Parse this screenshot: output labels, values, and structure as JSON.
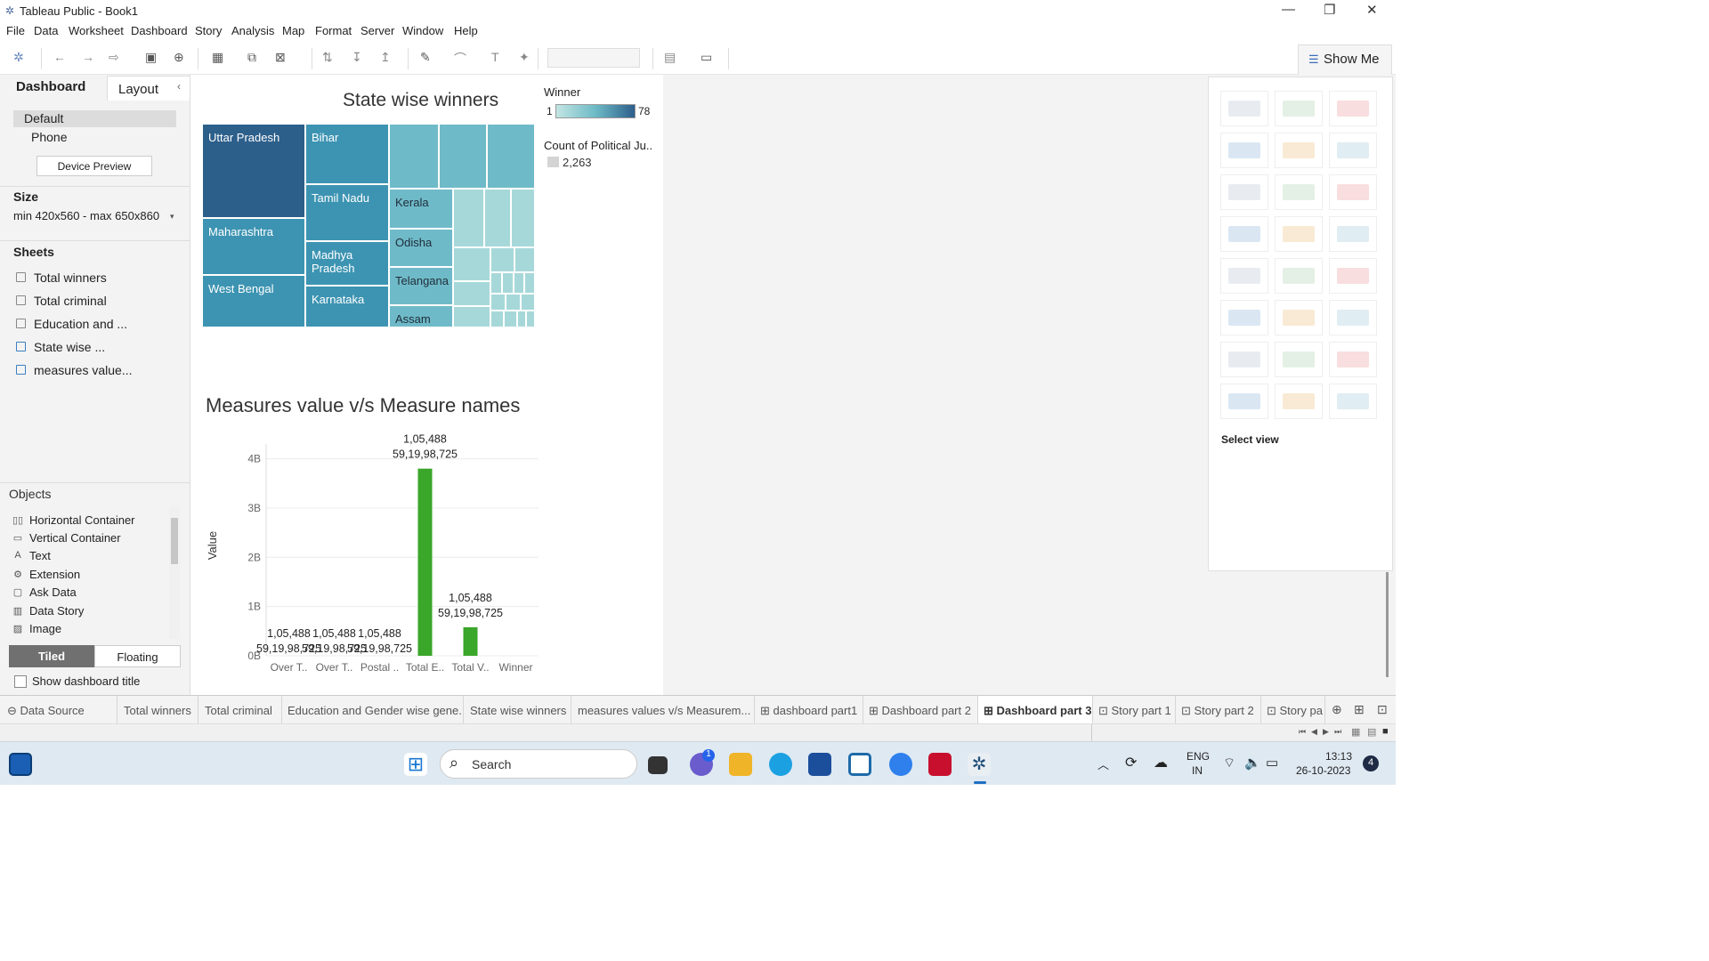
{
  "window": {
    "title": "Tableau Public - Book1"
  },
  "menu": [
    "File",
    "Data",
    "Worksheet",
    "Dashboard",
    "Story",
    "Analysis",
    "Map",
    "Format",
    "Server",
    "Window",
    "Help"
  ],
  "show_me": {
    "label": "Show Me",
    "select_view": "Select view"
  },
  "left_panel": {
    "tab_dashboard": "Dashboard",
    "tab_layout": "Layout",
    "device_default": "Default",
    "device_phone": "Phone",
    "device_preview": "Device Preview",
    "size_title": "Size",
    "size_value": "min 420x560 - max 650x860",
    "sheets_title": "Sheets",
    "sheets": [
      "Total winners",
      "Total criminal",
      "Education and ...",
      "State wise ...",
      "measures value..."
    ],
    "objects_title": "Objects",
    "objects": [
      {
        "label": "Horizontal Container",
        "icon": "horizontal-container-icon"
      },
      {
        "label": "Vertical Container",
        "icon": "vertical-container-icon"
      },
      {
        "label": "Text",
        "icon": "text-icon"
      },
      {
        "label": "Extension",
        "icon": "extension-icon"
      },
      {
        "label": "Ask Data",
        "icon": "ask-data-icon"
      },
      {
        "label": "Data Story",
        "icon": "data-story-icon"
      },
      {
        "label": "Image",
        "icon": "image-icon"
      }
    ],
    "tiled": "Tiled",
    "floating": "Floating",
    "show_title": "Show dashboard title"
  },
  "treemap": {
    "title": "State wise winners",
    "legend_title": "Winner",
    "legend_min": "1",
    "legend_max": "78",
    "count_title": "Count of Political Ju..",
    "count_value": "2,263",
    "labels": [
      "Uttar Pradesh",
      "Bihar",
      "Maharashtra",
      "Tamil Nadu",
      "West Bengal",
      "Madhya Pradesh",
      "Karnataka",
      "Kerala",
      "Odisha",
      "Telangana",
      "Assam"
    ],
    "colors": {
      "dark": "#2d5f8b",
      "mid": "#3d94b2",
      "light": "#6fbac8",
      "pale": "#a7d8d9"
    }
  },
  "chart_data": {
    "type": "bar",
    "title": "Measures value v/s Measure names",
    "ylabel": "Value",
    "categories": [
      "Over T..",
      "Over T..",
      "Postal ..",
      "Total E..",
      "Total V..",
      "Winner"
    ],
    "values": [
      0,
      0,
      0,
      3.8,
      0.58,
      0
    ],
    "value_unit": "B",
    "ylim": [
      0,
      4.3
    ],
    "yticks": [
      "0B",
      "1B",
      "2B",
      "3B",
      "4B"
    ],
    "labels_top": [
      "1,05,488",
      "1,05,488",
      "1,05,488",
      "1,05,488",
      "1,05,488"
    ],
    "labels_bottom": [
      "59,19,98,725",
      "59,19,98,725",
      "59,19,98,725",
      "59,19,98,725",
      "59,19,98,725"
    ],
    "bar_color": "#3aa62a"
  },
  "sheet_tabs": [
    "Data Source",
    "Total winners",
    "Total criminal",
    "Education and Gender wise gene...",
    "State wise winners",
    "measures values v/s Measurem...",
    "dashboard part1",
    "Dashboard part 2",
    "Dashboard part 3",
    "Story part 1",
    "Story part 2",
    "Story pa"
  ],
  "taskbar": {
    "search": "Search",
    "lang": "ENG",
    "region": "IN",
    "time": "13:13",
    "date": "26-10-2023",
    "badge": "4",
    "chat_badge": "1"
  }
}
